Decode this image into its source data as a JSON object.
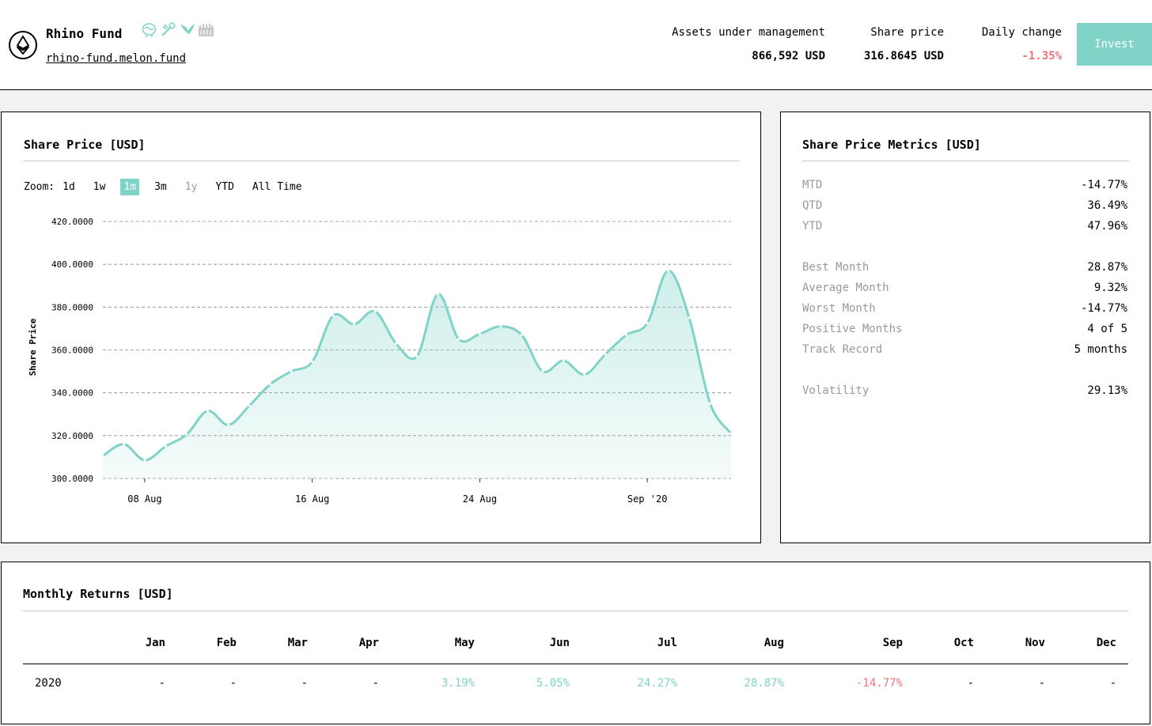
{
  "header": {
    "fund_name": "Rhino Fund",
    "fund_url": "rhino-fund.melon.fund",
    "aum_label": "Assets under management",
    "aum_value": "866,592 USD",
    "share_price_label": "Share price",
    "share_price_value": "316.8645 USD",
    "daily_change_label": "Daily change",
    "daily_change_value": "-1.35%",
    "invest_label": "Invest"
  },
  "chart_panel": {
    "title": "Share Price [USD]",
    "zoom_label": "Zoom:",
    "zoom_options": [
      "1d",
      "1w",
      "1m",
      "3m",
      "1y",
      "YTD",
      "All Time"
    ],
    "zoom_active": "1m"
  },
  "chart_data": {
    "type": "area",
    "ylabel": "Share Price",
    "ylim": [
      300,
      420
    ],
    "yticks": [
      "420.0000",
      "400.0000",
      "380.0000",
      "360.0000",
      "340.0000",
      "320.0000",
      "300.0000"
    ],
    "xticks": [
      "08 Aug",
      "16 Aug",
      "24 Aug",
      "Sep '20"
    ],
    "x": [
      "Aug 06",
      "Aug 07",
      "Aug 08",
      "Aug 09",
      "Aug 10",
      "Aug 11",
      "Aug 12",
      "Aug 13",
      "Aug 14",
      "Aug 15",
      "Aug 16",
      "Aug 17",
      "Aug 18",
      "Aug 19",
      "Aug 20",
      "Aug 21",
      "Aug 22",
      "Aug 23",
      "Aug 24",
      "Aug 25",
      "Aug 26",
      "Aug 27",
      "Aug 28",
      "Aug 29",
      "Aug 30",
      "Aug 31",
      "Sep 01",
      "Sep 02",
      "Sep 03",
      "Sep 04",
      "Sep 05"
    ],
    "values": [
      310.5,
      316,
      308.5,
      315,
      320.5,
      331.5,
      325,
      334,
      344,
      350,
      354.5,
      376,
      372,
      378,
      363,
      357,
      386,
      365,
      367.5,
      371,
      367,
      350,
      355,
      348.5,
      358,
      367,
      372.5,
      397,
      375,
      335,
      321
    ],
    "grid": true,
    "color": "#7fd3c7"
  },
  "metrics_panel": {
    "title": "Share Price Metrics [USD]",
    "rows": [
      {
        "label": "MTD",
        "value": "-14.77%"
      },
      {
        "label": "QTD",
        "value": "36.49%"
      },
      {
        "label": "YTD",
        "value": "47.96%"
      },
      {
        "label": "Best Month",
        "value": "28.87%"
      },
      {
        "label": "Average Month",
        "value": "9.32%"
      },
      {
        "label": "Worst Month",
        "value": "-14.77%"
      },
      {
        "label": "Positive Months",
        "value": "4 of 5"
      },
      {
        "label": "Track Record",
        "value": "5 months"
      },
      {
        "label": "Volatility",
        "value": "29.13%"
      }
    ]
  },
  "returns_panel": {
    "title": "Monthly Returns [USD]",
    "months": [
      "Jan",
      "Feb",
      "Mar",
      "Apr",
      "May",
      "Jun",
      "Jul",
      "Aug",
      "Sep",
      "Oct",
      "Nov",
      "Dec"
    ],
    "year": "2020",
    "values": [
      "-",
      "-",
      "-",
      "-",
      "3.19%",
      "5.05%",
      "24.27%",
      "28.87%",
      "-14.77%",
      "-",
      "-",
      "-"
    ]
  },
  "colors": {
    "accent": "#7fd3c7",
    "negative": "#f0717a"
  }
}
